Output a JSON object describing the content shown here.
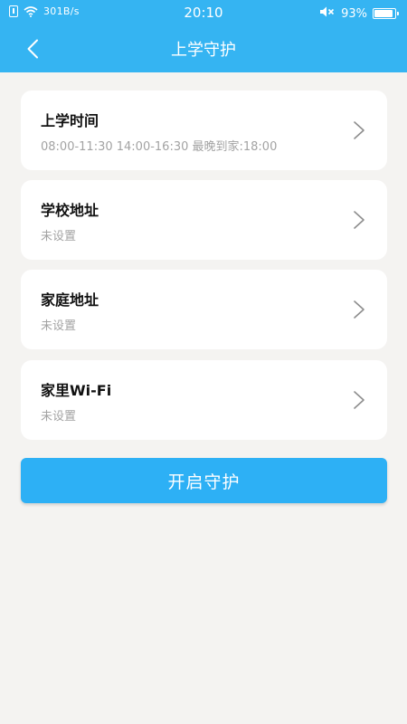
{
  "status_bar": {
    "speed": "301B/s",
    "time": "20:10",
    "battery": "93%",
    "battery_level": 0.93
  },
  "nav": {
    "title": "上学守护",
    "back_icon": "chevron-left-icon"
  },
  "items": [
    {
      "title": "上学时间",
      "subtitle": "08:00-11:30 14:00-16:30 最晚到家:18:00"
    },
    {
      "title": "学校地址",
      "subtitle": "未设置"
    },
    {
      "title": "家庭地址",
      "subtitle": "未设置"
    },
    {
      "title": "家里Wi-Fi",
      "subtitle": "未设置"
    }
  ],
  "action": {
    "label": "开启守护"
  },
  "colors": {
    "header": "#35b4f2",
    "button": "#2db0f5",
    "background": "#f4f3f1"
  }
}
